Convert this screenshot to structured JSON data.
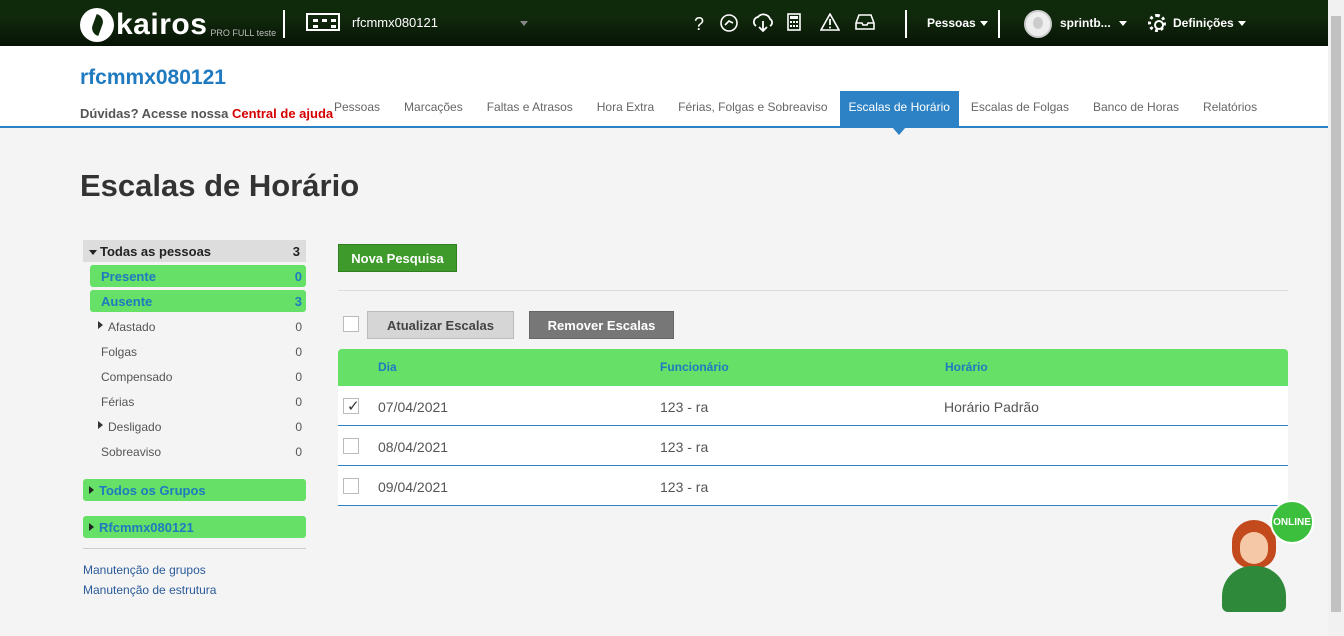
{
  "topbar": {
    "logo_text": "kairos",
    "logo_sub": "PRO FULL teste",
    "company": "rfcmmx080121",
    "icons": [
      "help-icon",
      "chat-icon",
      "cloud-download-icon",
      "calculator-icon",
      "warning-icon",
      "inbox-icon"
    ],
    "people_menu": "Pessoas",
    "user_name": "sprintb...",
    "settings_menu": "Definições"
  },
  "header": {
    "company_title": "rfcmmx080121",
    "help_text": "Dúvidas? Acesse nossa ",
    "help_link": "Central de ajuda",
    "nav": [
      "Pessoas",
      "Marcações",
      "Faltas e Atrasos",
      "Hora Extra",
      "Férias, Folgas e Sobreaviso",
      "Escalas de Horário",
      "Escalas de Folgas",
      "Banco de Horas",
      "Relatórios"
    ],
    "active_nav": "Escalas de Horário"
  },
  "page_title": "Escalas de Horário",
  "sidebar": {
    "all_people": {
      "label": "Todas as pessoas",
      "count": "3"
    },
    "present": {
      "label": "Presente",
      "count": "0"
    },
    "absent": {
      "label": "Ausente",
      "count": "3"
    },
    "rows": [
      {
        "label": "Afastado",
        "count": "0",
        "expandable": true
      },
      {
        "label": "Folgas",
        "count": "0",
        "expandable": false
      },
      {
        "label": "Compensado",
        "count": "0",
        "expandable": false
      },
      {
        "label": "Férias",
        "count": "0",
        "expandable": false
      },
      {
        "label": "Desligado",
        "count": "0",
        "expandable": true
      },
      {
        "label": "Sobreaviso",
        "count": "0",
        "expandable": false
      }
    ],
    "all_groups": "Todos os Grupos",
    "group_company": "Rfcmmx080121",
    "link_groups": "Manutenção de grupos",
    "link_structure": "Manutenção de estrutura"
  },
  "main": {
    "new_search": "Nova Pesquisa",
    "update_btn": "Atualizar Escalas",
    "remove_btn": "Remover Escalas",
    "columns": {
      "day": "Dia",
      "employee": "Funcionário",
      "schedule": "Horário"
    },
    "rows": [
      {
        "day": "07/04/2021",
        "employee": "123 - ra",
        "schedule": "Horário Padrão",
        "checked": true
      },
      {
        "day": "08/04/2021",
        "employee": "123 - ra",
        "schedule": "",
        "checked": false
      },
      {
        "day": "09/04/2021",
        "employee": "123 - ra",
        "schedule": "",
        "checked": false
      }
    ]
  },
  "online_badge": "ONLINE",
  "colors": {
    "topbar": "#0e2a0a",
    "accent_blue": "#2c82c4",
    "green": "#66e066",
    "button_green": "#3e9a2a",
    "help_red": "#d60000"
  }
}
